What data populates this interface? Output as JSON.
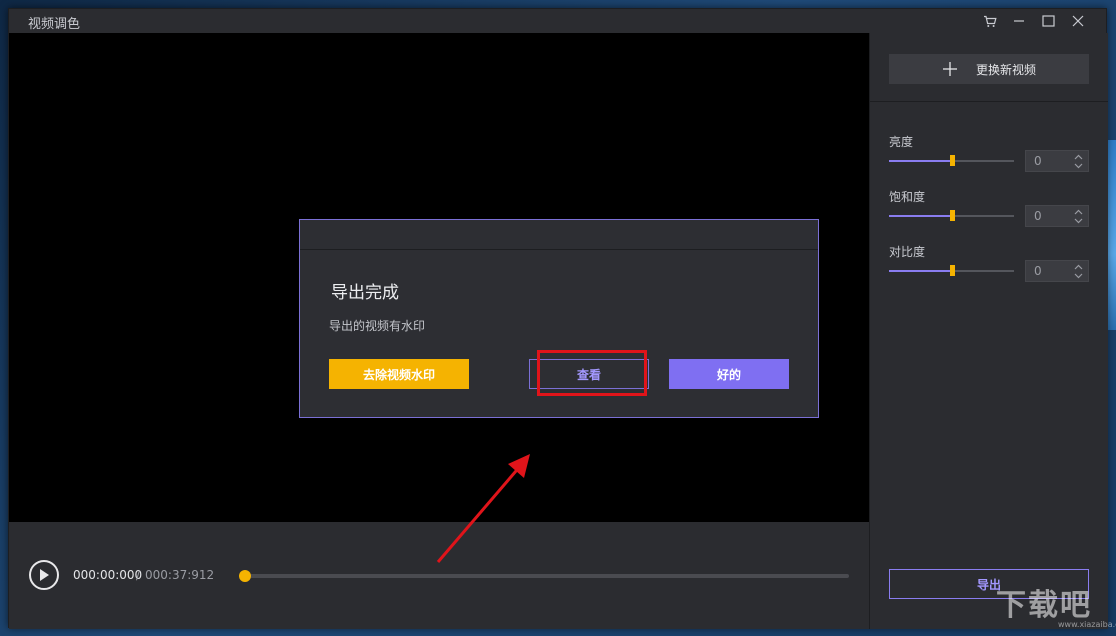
{
  "window": {
    "title": "视频调色"
  },
  "player": {
    "current_time": "000:00:000",
    "separator": "/",
    "total_time": "000:37:912",
    "progress_fraction": 0.0
  },
  "side_panel": {
    "replace_button_label": "更换新视频",
    "sliders": [
      {
        "label": "亮度",
        "value": "0",
        "level": 0.5
      },
      {
        "label": "饱和度",
        "value": "0",
        "level": 0.5
      },
      {
        "label": "对比度",
        "value": "0",
        "level": 0.5
      }
    ],
    "export_button_label": "导出"
  },
  "dialog": {
    "title": "导出完成",
    "message": "导出的视频有水印",
    "remove_watermark_label": "去除视频水印",
    "view_label": "查看",
    "ok_label": "好的"
  },
  "watermark": {
    "logo_text": "下载吧",
    "url": "www.xiazaiba.com"
  },
  "colors": {
    "accent_yellow": "#f5b301",
    "accent_purple": "#7f6ff2",
    "annotation_red": "#e0141a",
    "panel_bg": "#2b2c30",
    "video_bg": "#000000"
  },
  "icons": {
    "cart": "cart-icon",
    "minimize": "minimize-icon",
    "maximize": "maximize-icon",
    "close": "close-icon",
    "plus": "plus-icon",
    "play": "play-icon",
    "spin": "spin-arrows-icon"
  }
}
